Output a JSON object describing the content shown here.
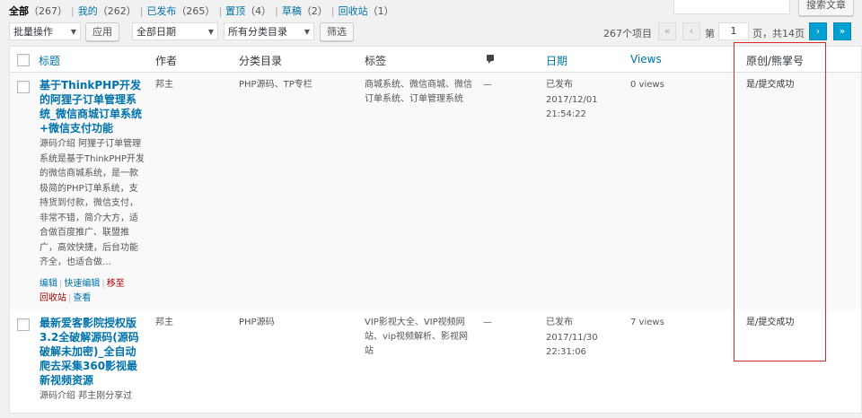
{
  "filters": [
    {
      "label": "全部",
      "count": "（267）"
    },
    {
      "label": "我的",
      "count": "（262）"
    },
    {
      "label": "已发布",
      "count": "（265）"
    },
    {
      "label": "置顶",
      "count": "（4）"
    },
    {
      "label": "草稿",
      "count": "（2）"
    },
    {
      "label": "回收站",
      "count": "（1）"
    }
  ],
  "search": {
    "button": "搜索文章",
    "value": ""
  },
  "tablenav": {
    "bulk": "批量操作",
    "apply": "应用",
    "dates": "全部日期",
    "cats": "所有分类目录",
    "filter": "筛选",
    "items": "267个项目",
    "first": "«",
    "prev": "‹",
    "page_prefix": "第",
    "page": "1",
    "page_suffix": "页，共14页",
    "next": "›",
    "last": "»"
  },
  "columns": {
    "title": "标题",
    "author": "作者",
    "categories": "分类目录",
    "tags": "标签",
    "date": "日期",
    "views": "Views",
    "original": "原创/熊掌号"
  },
  "posts": [
    {
      "title": "基于ThinkPHP开发的阿狸子订单管理系统_微信商城订单系统+微信支付功能",
      "excerpt": "源码介绍 阿狸子订单管理系统是基于ThinkPHP开发的微信商城系统，是一款极简的PHP订单系统，支持货到付款，微信支付，非常不错，简介大方，适合做百度推广、联盟推广，高效快捷，后台功能齐全，也适合做…",
      "actions": {
        "edit": "编辑",
        "quick": "快速编辑",
        "trash1": "移至",
        "trash2": "回收站",
        "view": "查看"
      },
      "author": "邦主",
      "categories": "PHP源码、TP专栏",
      "tags": "商城系统、微信商城、微信订单系统、订单管理系统",
      "comments": "—",
      "status": "已发布",
      "date": "2017/12/01",
      "time": "21:54:22",
      "views": "0 views",
      "original": "是/提交成功"
    },
    {
      "title": "最新爱客影院授权版3.2全破解源码(源码破解未加密)_全自动爬去采集360影视最新视频资源",
      "excerpt": "源码介绍 邦主刚分享过",
      "author": "邦主",
      "categories": "PHP源码",
      "tags": "VIP影视大全、VIP视频网站、vip视频解析、影视网站",
      "comments": "—",
      "status": "已发布",
      "date": "2017/11/30",
      "time": "22:31:06",
      "views": "7 views",
      "original": "是/提交成功"
    }
  ]
}
